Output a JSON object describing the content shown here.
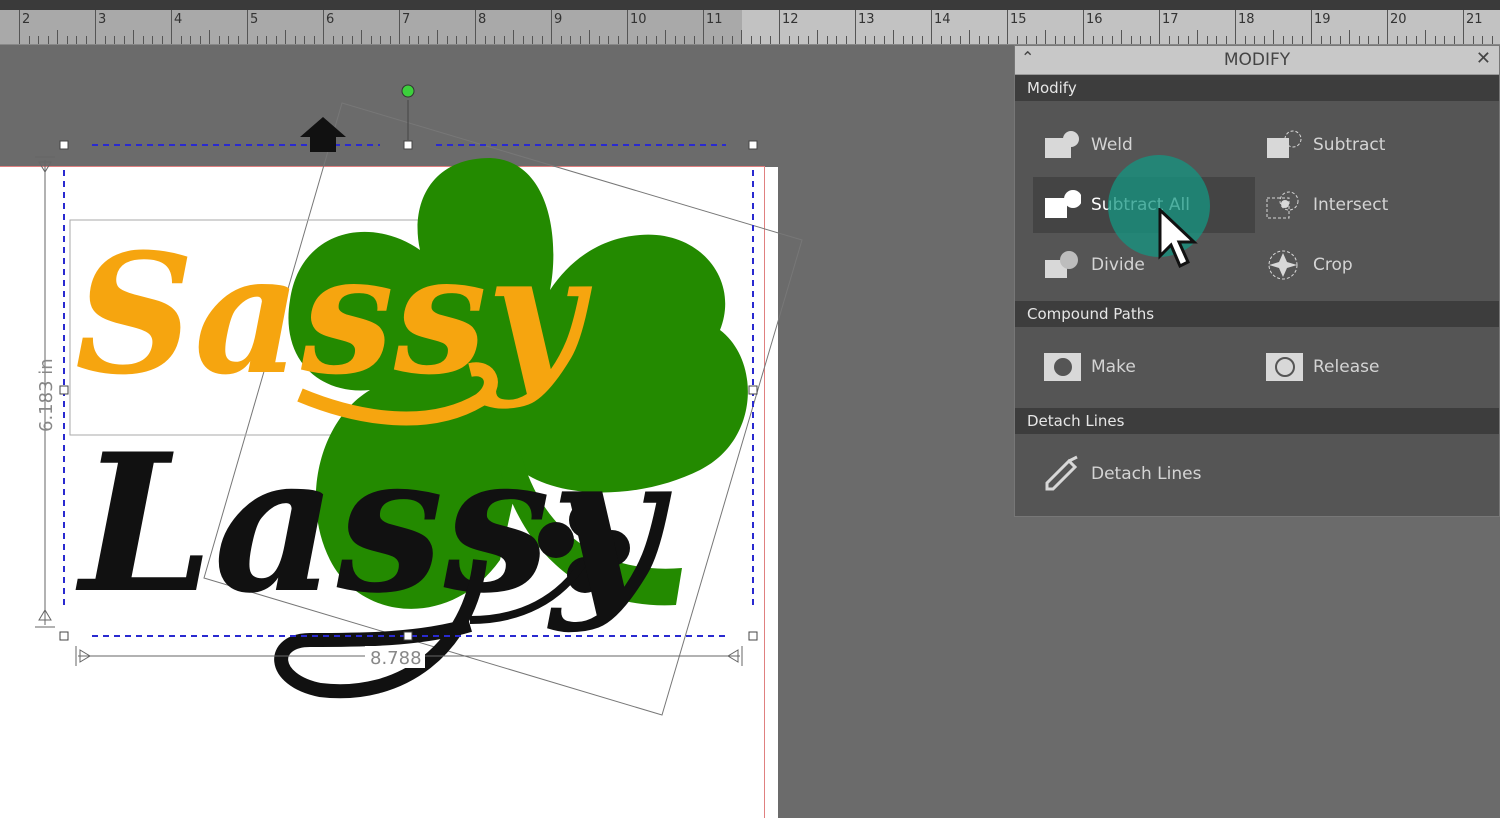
{
  "ruler": {
    "labels": [
      "2",
      "3",
      "4",
      "5",
      "6",
      "7",
      "8",
      "9",
      "10",
      "11",
      "12",
      "13",
      "14",
      "15",
      "16",
      "17",
      "18",
      "19",
      "20",
      "21"
    ]
  },
  "design": {
    "text_top": "Sassy",
    "text_bottom": "Lassy",
    "width_label": "8.788",
    "height_label": "6.183 in",
    "colors": {
      "orange": "#f6a50f",
      "green": "#238a00",
      "black": "#111111"
    }
  },
  "panel": {
    "title": "MODIFY",
    "sections": {
      "modify": {
        "heading": "Modify",
        "weld": "Weld",
        "subtract": "Subtract",
        "subtract_all": "Subtract All",
        "intersect": "Intersect",
        "divide": "Divide",
        "crop": "Crop"
      },
      "compound": {
        "heading": "Compound Paths",
        "make": "Make",
        "release": "Release"
      },
      "detach": {
        "heading": "Detach Lines",
        "detach_lines": "Detach Lines"
      }
    }
  }
}
